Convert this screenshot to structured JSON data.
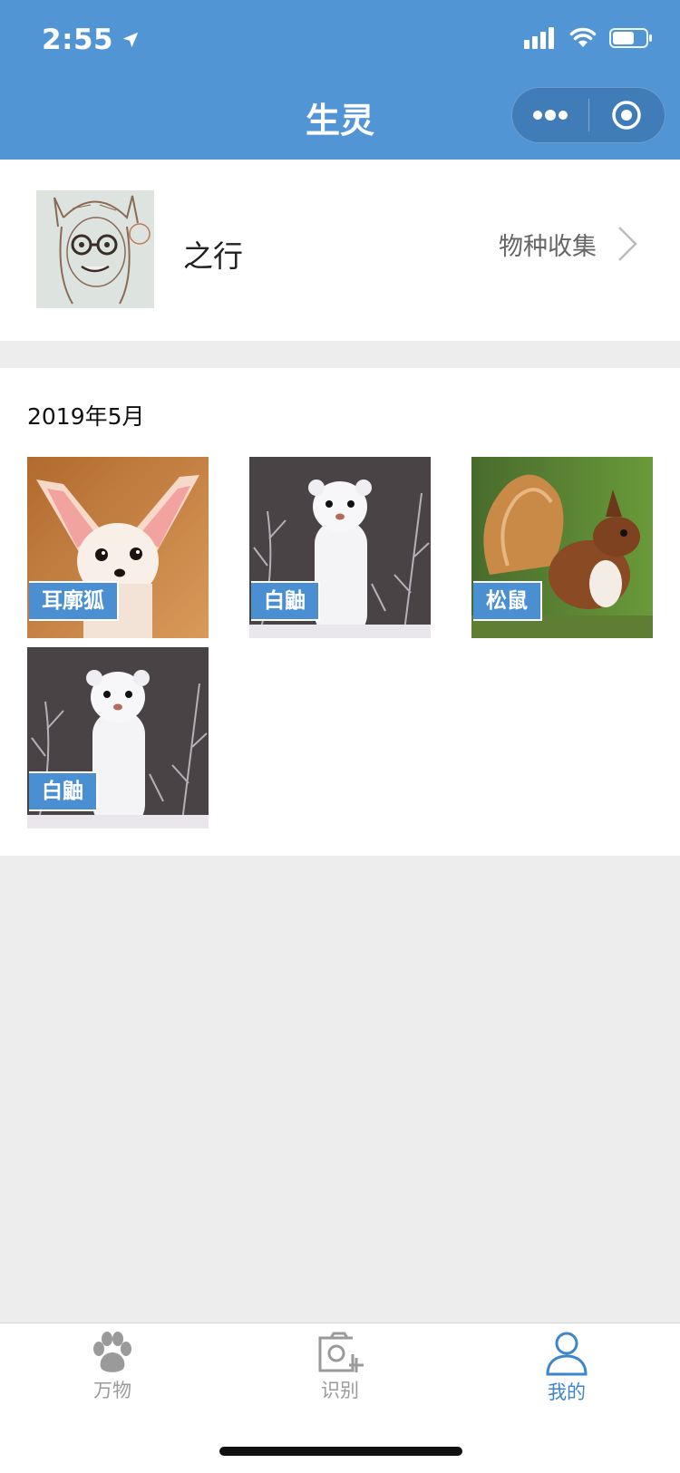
{
  "status_bar": {
    "time": "2:55"
  },
  "nav": {
    "title": "生灵"
  },
  "profile": {
    "name": "之行",
    "collect_label": "物种收集"
  },
  "gallery": {
    "month": "2019年5月",
    "items": [
      {
        "label": "耳廓狐",
        "icon": "fennec-fox-photo"
      },
      {
        "label": "白鼬",
        "icon": "white-weasel-photo"
      },
      {
        "label": "松鼠",
        "icon": "squirrel-photo"
      },
      {
        "label": "白鼬",
        "icon": "white-weasel-photo"
      }
    ]
  },
  "tabs": [
    {
      "label": "万物",
      "icon": "paw-icon",
      "active": false
    },
    {
      "label": "识别",
      "icon": "camera-add-icon",
      "active": false
    },
    {
      "label": "我的",
      "icon": "user-icon",
      "active": true
    }
  ],
  "colors": {
    "brand": "#5195d4",
    "label_bg": "#4b8fd3",
    "tab_active": "#3d86cc",
    "tab_inactive": "#9a9a9a"
  }
}
